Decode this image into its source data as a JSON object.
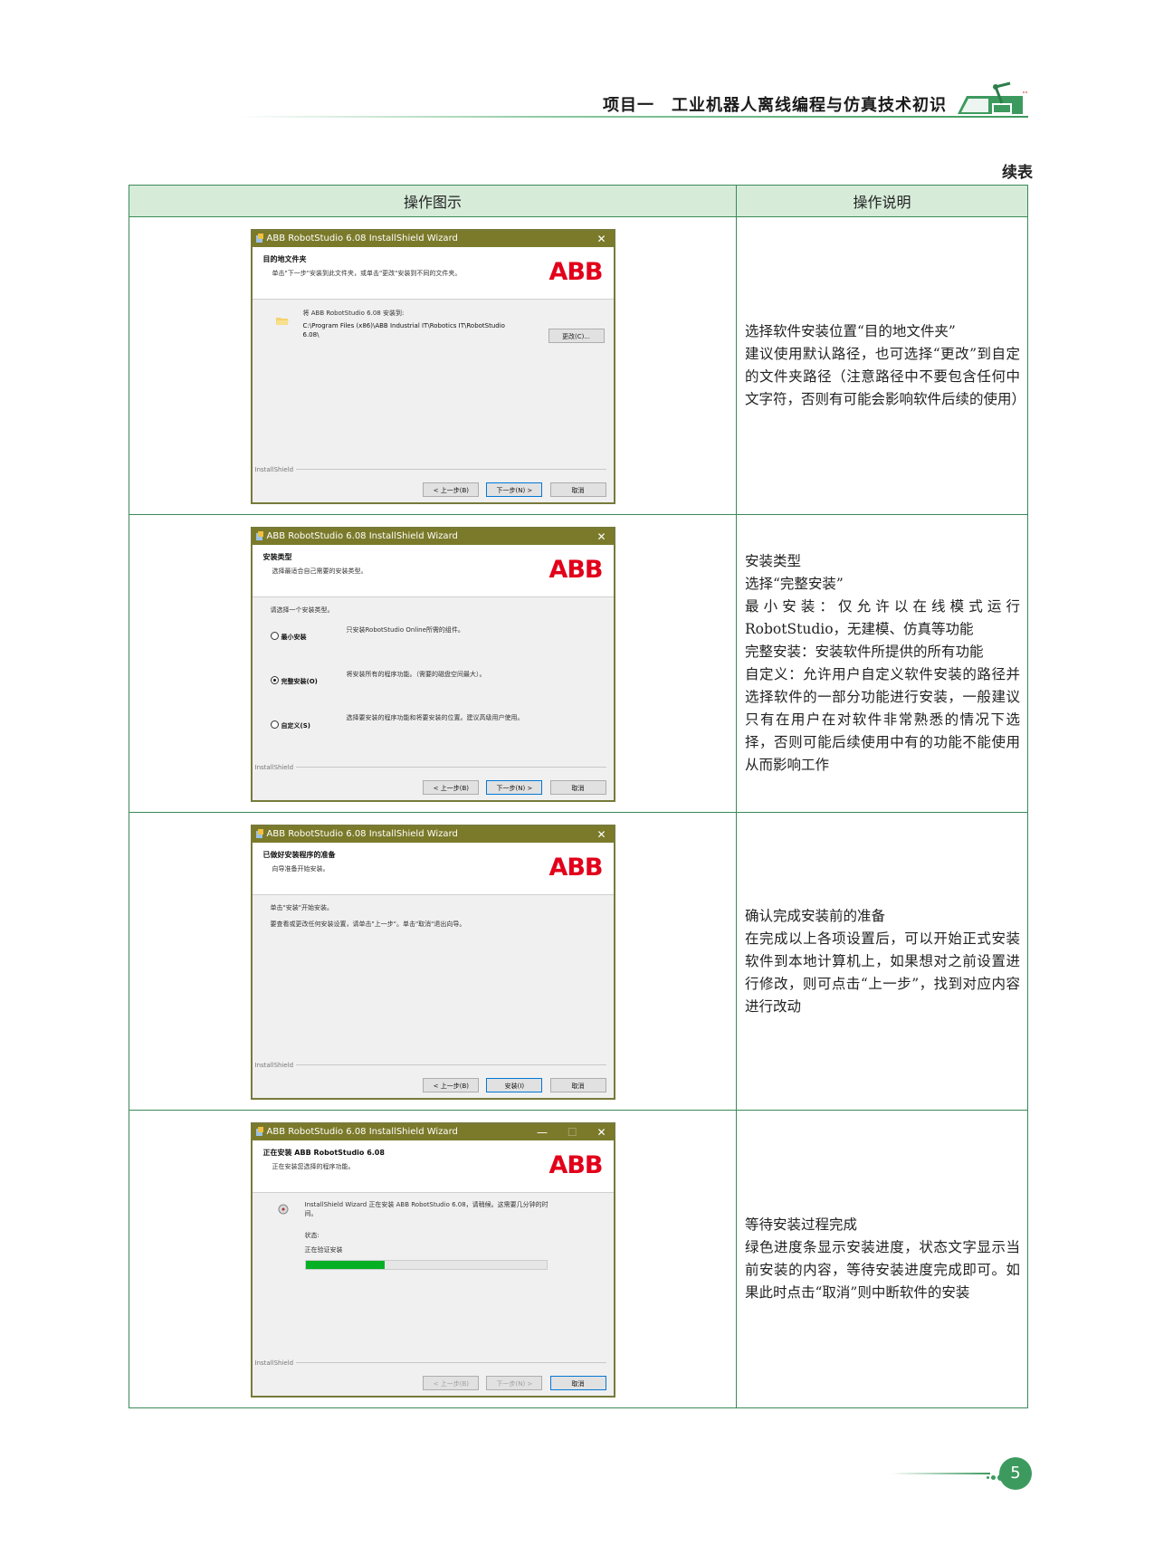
{
  "header": {
    "title": "项目一　工业机器人离线编程与仿真技术初识"
  },
  "continued_label": "续表",
  "table": {
    "headers": {
      "image": "操作图示",
      "description": "操作说明"
    },
    "rows": [
      {
        "window": {
          "title": "ABB RobotStudio 6.08 InstallShield Wizard",
          "heading": "目的地文件夹",
          "subheading": "单击\"下一步\"安装到此文件夹，或单击\"更改\"安装到不同的文件夹。",
          "install_to": "将 ABB RobotStudio 6.08 安装到:",
          "path": "C:\\Program Files (x86)\\ABB Industrial IT\\Robotics IT\\RobotStudio 6.08\\",
          "change_button": "更改(C)...",
          "installshield": "InstallShield",
          "buttons": {
            "back": "< 上一步(B)",
            "next": "下一步(N) >",
            "cancel": "取消"
          }
        },
        "desc": [
          "选择软件安装位置“目的地文件夹”",
          "建议使用默认路径，也可选择“更改”到自定的文件夹路径（注意路径中不要包含任何中文字符，否则有可能会影响软件后续的使用）"
        ]
      },
      {
        "window": {
          "title": "ABB RobotStudio 6.08 InstallShield Wizard",
          "heading": "安装类型",
          "subheading": "选择最适合自己需要的安装类型。",
          "prompt": "请选择一个安装类型。",
          "options": [
            {
              "label": "最小安装",
              "desc": "只安装RobotStudio Online所需的组件。",
              "selected": false
            },
            {
              "label": "完整安装(O)",
              "desc": "将安装所有的程序功能。（需要的磁盘空间最大）。",
              "selected": true
            },
            {
              "label": "自定义(S)",
              "desc": "选择要安装的程序功能和将要安装的位置。建议高级用户使用。",
              "selected": false
            }
          ],
          "installshield": "InstallShield",
          "buttons": {
            "back": "< 上一步(B)",
            "next": "下一步(N) >",
            "cancel": "取消"
          }
        },
        "desc": [
          "安装类型",
          "选择“完整安装”",
          "最小安装：仅允许以在线模式运行RobotStudio，无建模、仿真等功能",
          "完整安装：安装软件所提供的所有功能",
          "自定义：允许用户自定义软件安装的路径并选择软件的一部分功能进行安装，一般建议只有在用户在对软件非常熟悉的情况下选择，否则可能后续使用中有的功能不能使用从而影响工作"
        ]
      },
      {
        "window": {
          "title": "ABB RobotStudio 6.08 InstallShield Wizard",
          "heading": "已做好安装程序的准备",
          "subheading": "向导准备开始安装。",
          "line1": "单击\"安装\"开始安装。",
          "line2": "要查看或更改任何安装设置，请单击\"上一步\"。单击\"取消\"退出向导。",
          "installshield": "InstallShield",
          "buttons": {
            "back": "< 上一步(B)",
            "next": "安装(I)",
            "cancel": "取消"
          }
        },
        "desc": [
          "确认完成安装前的准备",
          "在完成以上各项设置后，可以开始正式安装软件到本地计算机上，如果想对之前设置进行修改，则可点击“上一步”，找到对应内容进行改动"
        ]
      },
      {
        "window": {
          "title": "ABB RobotStudio 6.08 InstallShield Wizard",
          "heading": "正在安装 ABB RobotStudio 6.08",
          "subheading": "正在安装您选择的程序功能。",
          "wait_text": "InstallShield Wizard 正在安装 ABB RobotStudio 6.08，请稍候。这需要几分钟的时间。",
          "status_label": "状态:",
          "status_value": "正在验证安装",
          "progress": 0.33,
          "installshield": "InstallShield",
          "buttons": {
            "back": "< 上一步(B)",
            "next": "下一步(N) >",
            "cancel": "取消"
          }
        },
        "desc": [
          "等待安装过程完成",
          "绿色进度条显示安装进度，状态文字显示当前安装的内容，等待安装进度完成即可。如果此时点击“取消”则中断软件的安装"
        ]
      }
    ]
  },
  "page_number": "5",
  "colors": {
    "accent": "#3d9a5e",
    "header_fill": "#d6ecd9",
    "abb_red": "#e2001a",
    "titlebar": "#7b7a2a",
    "progress": "#06b025"
  }
}
